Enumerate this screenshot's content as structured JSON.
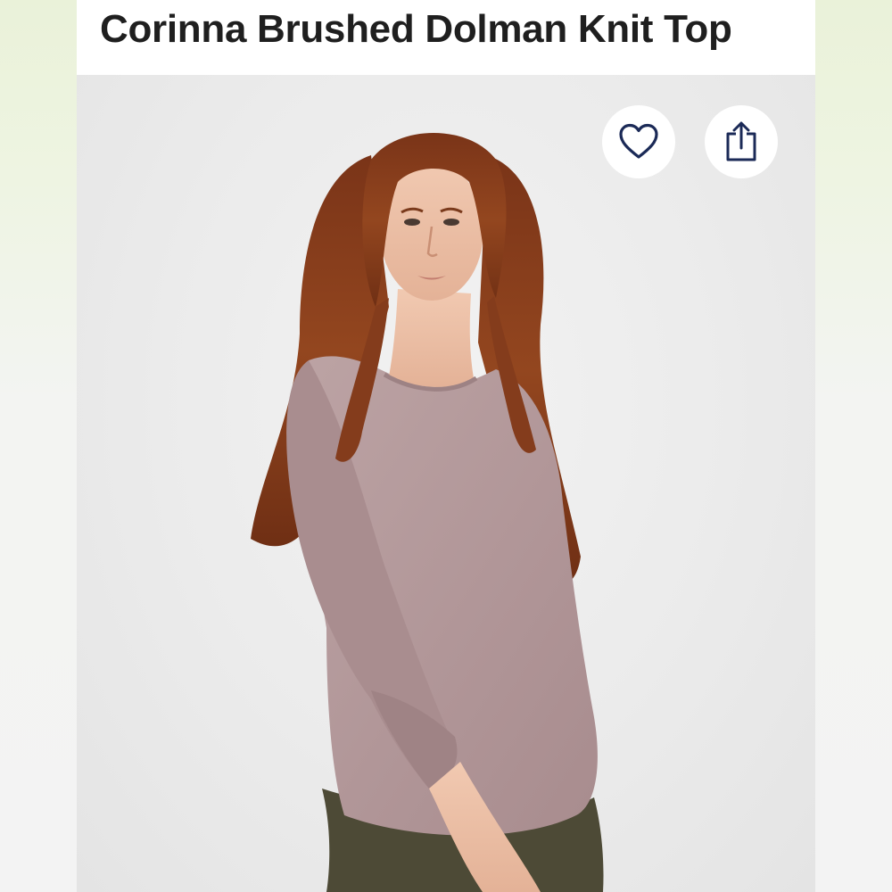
{
  "product": {
    "title": "Corinna Brushed Dolman Knit Top",
    "image_alt": "Model wearing the Corinna Brushed Dolman Knit Top in heathered mauve with olive pants"
  },
  "actions": {
    "favorite_icon": "heart-outline-icon",
    "share_icon": "share-upload-icon"
  },
  "colors": {
    "title_text": "#1f1f1f",
    "icon_stroke": "#1b2a57",
    "top_fabric": "#b49a9b",
    "hair": "#8a3f1f",
    "pants": "#4d4a36"
  }
}
